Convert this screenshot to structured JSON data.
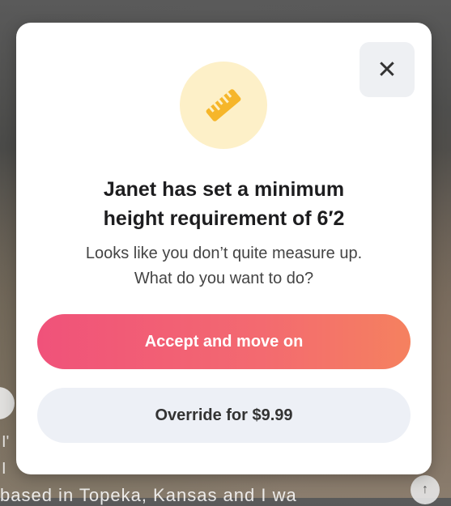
{
  "dialog": {
    "title_line1": "Janet has set a minimum",
    "title_line2": "height requirement of 6′2",
    "subtitle_line1": "Looks like you don’t quite measure up.",
    "subtitle_line2": "What do you want to do?",
    "icon": "ruler-icon",
    "close_label": "✕",
    "accept_label": "Accept and move on",
    "override_label": "Override for $9.99"
  },
  "background": {
    "bottom_text": "based in Topeka, Kansas and I wa",
    "frag_1": "I'",
    "frag_2": "I"
  },
  "colors": {
    "accent_start": "#f0527a",
    "accent_end": "#f5815f",
    "icon_bg": "#fdf0c8",
    "icon": "#f6b62a"
  }
}
